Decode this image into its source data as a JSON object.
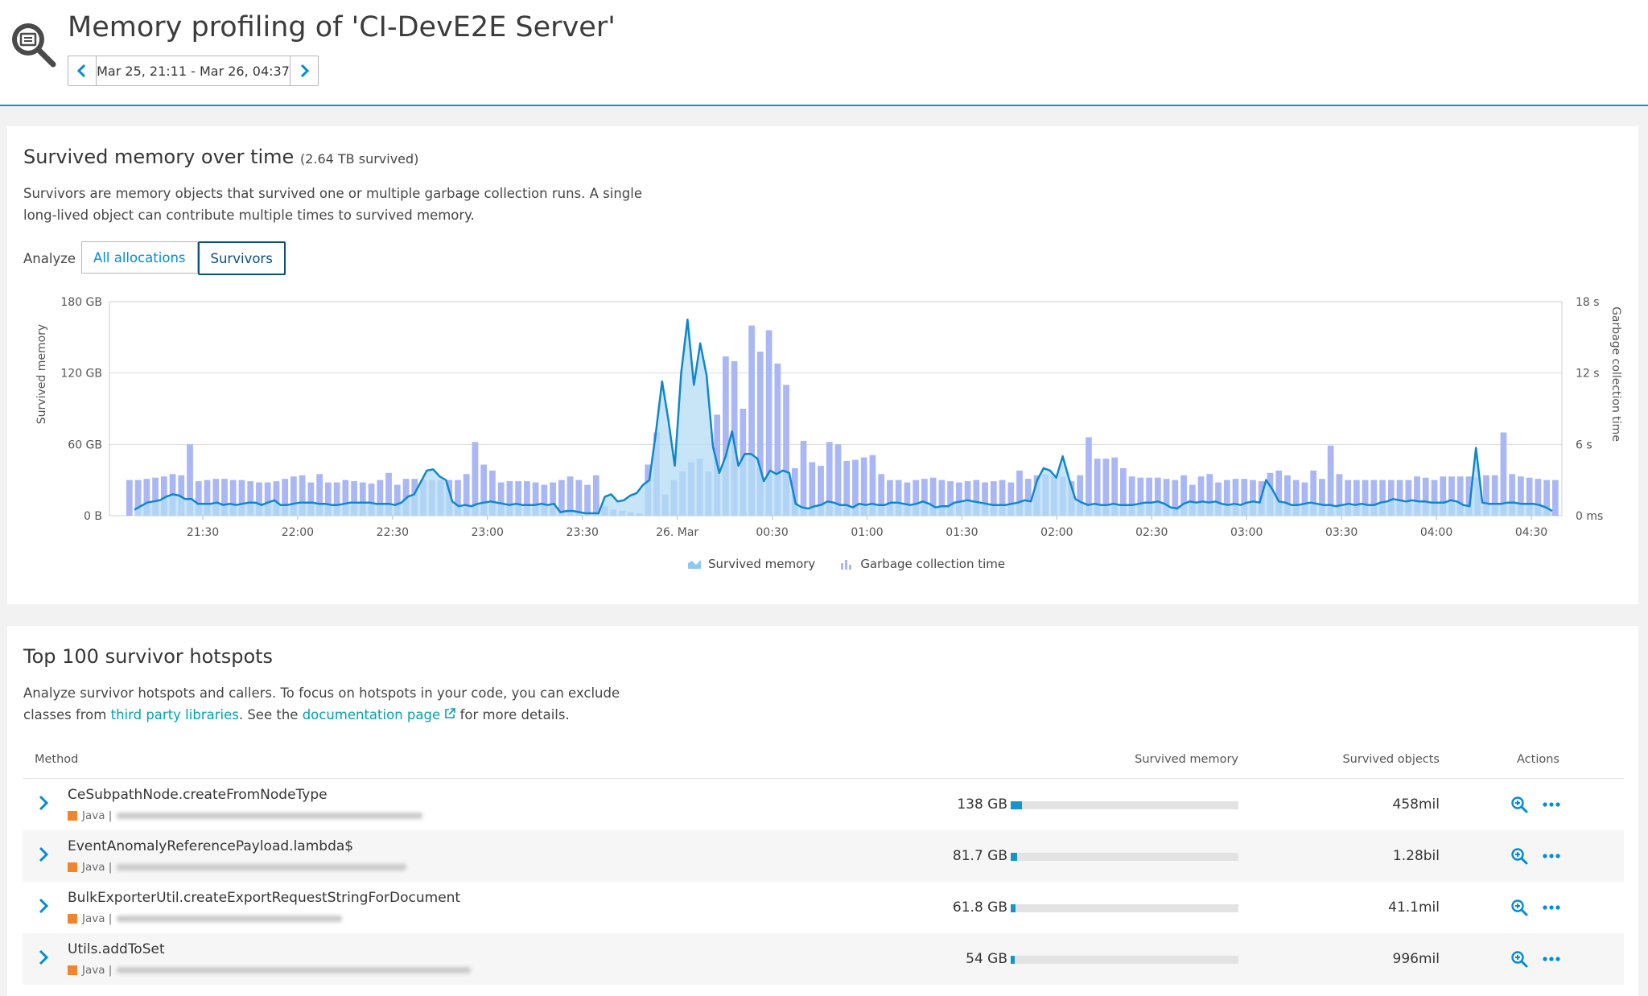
{
  "header": {
    "title": "Memory profiling of 'CI-DevE2E Server'",
    "timeframe": "Mar 25, 21:11 - Mar 26, 04:37"
  },
  "survived_panel": {
    "title": "Survived memory over time",
    "subtitle": "(2.64 TB survived)",
    "desc_line1": "Survivors are memory objects that survived one or multiple garbage collection runs. A single",
    "desc_line2": "long-lived object can contribute multiple times to survived memory.",
    "analyze_label": "Analyze",
    "btn_all": "All allocations",
    "btn_survivors": "Survivors",
    "legend_survived": "Survived memory",
    "legend_gc": "Garbage collection time"
  },
  "chart_data": {
    "type": "bar",
    "ylabel_left": "Survived memory",
    "ylabel_right": "Garbage collection time",
    "y_left_ticks": [
      "180 GB",
      "120 GB",
      "60 GB",
      "0 B"
    ],
    "y_right_ticks": [
      "18 s",
      "12 s",
      "6 s",
      "0 ms"
    ],
    "ylim_left_gb": [
      0,
      180
    ],
    "ylim_right_s": [
      0,
      18
    ],
    "x_ticks": [
      "21:30",
      "22:00",
      "22:30",
      "23:00",
      "23:30",
      "26. Mar",
      "00:30",
      "01:00",
      "01:30",
      "02:00",
      "02:30",
      "03:00",
      "03:30",
      "04:00",
      "04:30"
    ],
    "x_range": [
      "Mar 25, 21:11",
      "Mar 26, 04:37"
    ],
    "grid": true,
    "legend_position": "bottom",
    "series": [
      {
        "name": "Garbage collection time",
        "unit": "s",
        "values": [
          3.0,
          3.0,
          3.1,
          3.2,
          3.3,
          3.5,
          3.4,
          6.0,
          2.9,
          3.0,
          3.1,
          3.1,
          3.0,
          3.0,
          2.9,
          2.8,
          2.8,
          2.9,
          3.1,
          3.3,
          3.4,
          2.8,
          3.5,
          2.8,
          2.8,
          3.0,
          2.9,
          2.8,
          2.7,
          3.0,
          3.6,
          2.6,
          3.1,
          3.1,
          3.0,
          3.0,
          3.0,
          3.0,
          3.0,
          3.5,
          6.2,
          4.3,
          3.8,
          2.8,
          2.9,
          2.9,
          2.9,
          2.8,
          2.6,
          2.8,
          3.0,
          3.3,
          3.0,
          2.6,
          3.4,
          0.8,
          0.5,
          0.4,
          0.3,
          0.2,
          4.3,
          7.0,
          1.8,
          3.0,
          3.7,
          4.5,
          4.8,
          3.7,
          8.5,
          13.4,
          13.0,
          9.0,
          16.0,
          13.8,
          15.6,
          12.8,
          11.0,
          4.0,
          6.3,
          4.5,
          4.2,
          6.2,
          6.0,
          4.6,
          4.7,
          4.9,
          5.1,
          3.5,
          3.0,
          3.0,
          2.8,
          3.0,
          3.1,
          3.2,
          3.0,
          2.9,
          2.8,
          2.9,
          3.0,
          2.8,
          2.9,
          3.0,
          2.8,
          3.8,
          3.1,
          3.4,
          3.5,
          3.3,
          3.3,
          2.9,
          3.4,
          6.6,
          4.8,
          4.8,
          4.9,
          4.0,
          3.3,
          3.2,
          3.2,
          3.2,
          3.1,
          3.0,
          3.4,
          2.6,
          3.3,
          3.5,
          2.8,
          3.0,
          3.1,
          3.1,
          3.0,
          2.9,
          3.6,
          3.8,
          3.4,
          3.0,
          2.8,
          3.8,
          3.1,
          5.9,
          3.5,
          3.0,
          3.0,
          3.0,
          3.0,
          3.0,
          3.0,
          3.0,
          3.0,
          3.3,
          3.2,
          3.0,
          3.3,
          3.3,
          3.3,
          3.3,
          3.2,
          3.4,
          3.4,
          7.0,
          3.5,
          3.3,
          3.2,
          3.1,
          3.0,
          3.0
        ]
      },
      {
        "name": "Survived memory",
        "unit": "GB",
        "values": [
          5,
          8,
          11,
          12,
          13,
          16,
          18,
          17,
          14,
          14,
          10,
          10,
          10,
          11,
          9,
          10,
          9,
          10,
          11,
          11,
          9,
          11,
          13,
          9,
          9,
          10,
          11,
          11,
          11,
          10,
          10,
          9,
          9,
          10,
          11,
          11,
          11,
          11,
          10,
          10,
          10,
          9,
          11,
          16,
          18,
          28,
          38,
          39,
          33,
          30,
          12,
          8,
          9,
          8,
          10,
          11,
          12,
          11,
          10,
          9,
          10,
          9,
          9,
          9,
          10,
          9,
          10,
          3,
          4,
          4,
          3,
          2,
          2,
          2,
          16,
          18,
          12,
          13,
          17,
          19,
          26,
          30,
          69,
          113,
          80,
          42,
          120,
          165,
          110,
          145,
          118,
          58,
          36,
          50,
          71,
          42,
          52,
          52,
          48,
          29,
          38,
          35,
          38,
          36,
          10,
          7,
          6,
          8,
          9,
          12,
          11,
          9,
          9,
          7,
          10,
          9,
          10,
          9,
          9,
          11,
          11,
          10,
          9,
          10,
          12,
          10,
          7,
          8,
          8,
          11,
          12,
          13,
          12,
          11,
          10,
          9,
          9,
          9,
          10,
          11,
          13,
          12,
          30,
          40,
          38,
          32,
          50,
          31,
          14,
          11,
          9,
          10,
          9,
          9,
          10,
          9,
          9,
          9,
          10,
          11,
          11,
          12,
          10,
          7,
          6,
          10,
          12,
          11,
          12,
          11,
          12,
          10,
          9,
          10,
          9,
          11,
          12,
          11,
          30,
          22,
          12,
          11,
          9,
          9,
          10,
          11,
          10,
          9,
          9,
          8,
          9,
          10,
          9,
          10,
          9,
          9,
          11,
          12,
          14,
          13,
          12,
          13,
          12,
          12,
          11,
          11,
          11,
          13,
          12,
          9,
          8,
          57,
          11,
          10,
          10,
          10,
          11,
          11,
          10,
          10,
          10,
          9,
          7,
          4
        ]
      }
    ]
  },
  "hotspots_panel": {
    "title": "Top 100 survivor hotspots",
    "desc_line1": "Analyze survivor hotspots and callers. To focus on hotspots in your code, you can exclude",
    "desc_pre": "classes from ",
    "link_third_party": "third party libraries",
    "desc_mid": ". See the ",
    "link_docs": "documentation page",
    "desc_post": " for more details.",
    "col_method": "Method",
    "col_memory": "Survived memory",
    "col_objects": "Survived objects",
    "col_actions": "Actions",
    "rows": [
      {
        "method": "CeSubpathNode.createFromNodeType",
        "lang": "Java |",
        "memory": "138 GB",
        "memory_fraction": 0.05,
        "objects": "458mil"
      },
      {
        "method": "EventAnomalyReferencePayload.lambda$",
        "lang": "Java |",
        "memory": "81.7 GB",
        "memory_fraction": 0.03,
        "objects": "1.28bil"
      },
      {
        "method": "BulkExporterUtil.createExportRequestStringForDocument",
        "lang": "Java |",
        "memory": "61.8 GB",
        "memory_fraction": 0.02,
        "objects": "41.1mil"
      },
      {
        "method": "Utils.addToSet",
        "lang": "Java |",
        "memory": "54 GB",
        "memory_fraction": 0.018,
        "objects": "996mil"
      }
    ]
  },
  "colors": {
    "accent": "#1496c8",
    "line": "#0e87cc",
    "bar_gc": "#a9b7f5",
    "area_survived": "#b4dcf4",
    "link": "#00a1b2",
    "java": "#f1842d"
  }
}
